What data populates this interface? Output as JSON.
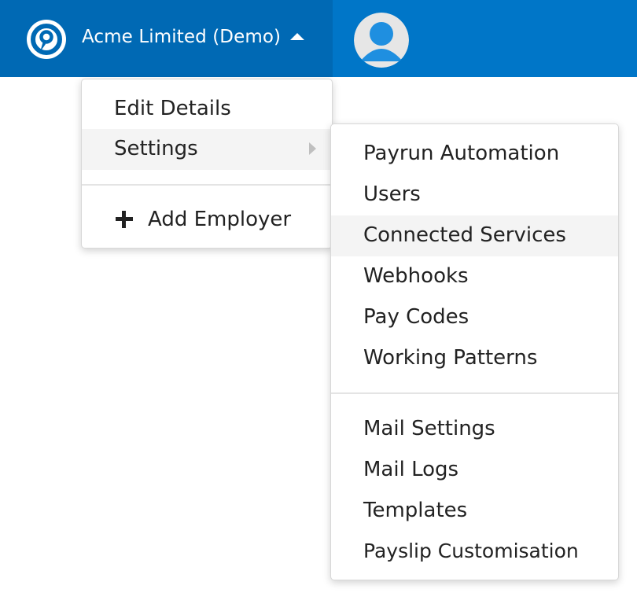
{
  "header": {
    "employer_name": "Acme Limited (Demo)",
    "logo_icon": "location-pin-logo-icon",
    "caret_icon": "caret-up-icon",
    "avatar_icon": "user-avatar-icon",
    "colors": {
      "bar": "#0076c8",
      "employer_section": "#0069b4"
    }
  },
  "employer_menu": {
    "items": [
      {
        "label": "Edit Details"
      },
      {
        "label": "Settings",
        "highlighted": true,
        "has_submenu": true
      }
    ],
    "add_employer": {
      "label": "Add Employer",
      "icon": "plus-icon"
    }
  },
  "settings_submenu": {
    "group1": [
      {
        "label": "Payrun Automation"
      },
      {
        "label": "Users"
      },
      {
        "label": "Connected Services",
        "highlighted": true
      },
      {
        "label": "Webhooks"
      },
      {
        "label": "Pay Codes"
      },
      {
        "label": "Working Patterns"
      }
    ],
    "group2": [
      {
        "label": "Mail Settings"
      },
      {
        "label": "Mail Logs"
      },
      {
        "label": "Templates"
      },
      {
        "label": "Payslip Customisation"
      }
    ]
  }
}
